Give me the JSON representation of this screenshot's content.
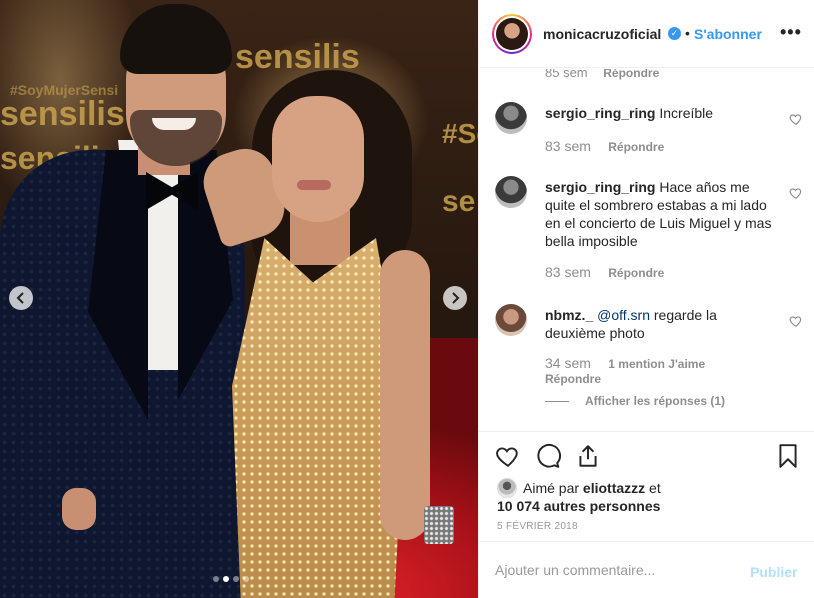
{
  "photo": {
    "background_texts": [
      "sensilis",
      "sensilis",
      "sensilis",
      "#Se",
      "se",
      "#SoyMujerSensi"
    ]
  },
  "header": {
    "username": "monicacruzoficial",
    "verified_icon": "verified-badge-icon",
    "separator": "•",
    "follow_label": "S'abonner",
    "more_label": "•••"
  },
  "comments": {
    "partial": {
      "time": "85 sem",
      "reply": "Répondre"
    },
    "items": [
      {
        "user": "sergio_ring_ring",
        "text": "Increíble",
        "time": "83 sem",
        "reply": "Répondre"
      },
      {
        "user": "sergio_ring_ring",
        "text": "Hace años me quite el sombrero estabas a mi lado en el concierto de Luis Miguel y mas bella imposible",
        "time": "83 sem",
        "reply": "Répondre"
      },
      {
        "user": "nbmz._",
        "mention": "@off.srn",
        "text": "regarde la deuxième photo",
        "time": "34 sem",
        "likes": "1 mention J'aime",
        "reply": "Répondre"
      }
    ],
    "view_replies": "Afficher les réponses (1)"
  },
  "likes": {
    "prefix": "Aimé par",
    "user": "eliottazzz",
    "suffix": "et",
    "others": "10 074 autres personnes"
  },
  "date": "5 FÉVRIER 2018",
  "add_comment": {
    "placeholder": "Ajouter un commentaire...",
    "post_label": "Publier"
  },
  "carousel": {
    "total_slides": 4,
    "active_slide": 2
  },
  "colors": {
    "accent": "#3897f0",
    "post_disabled": "#b2dffc",
    "meta": "#8e8e8e",
    "mention": "#003569"
  }
}
